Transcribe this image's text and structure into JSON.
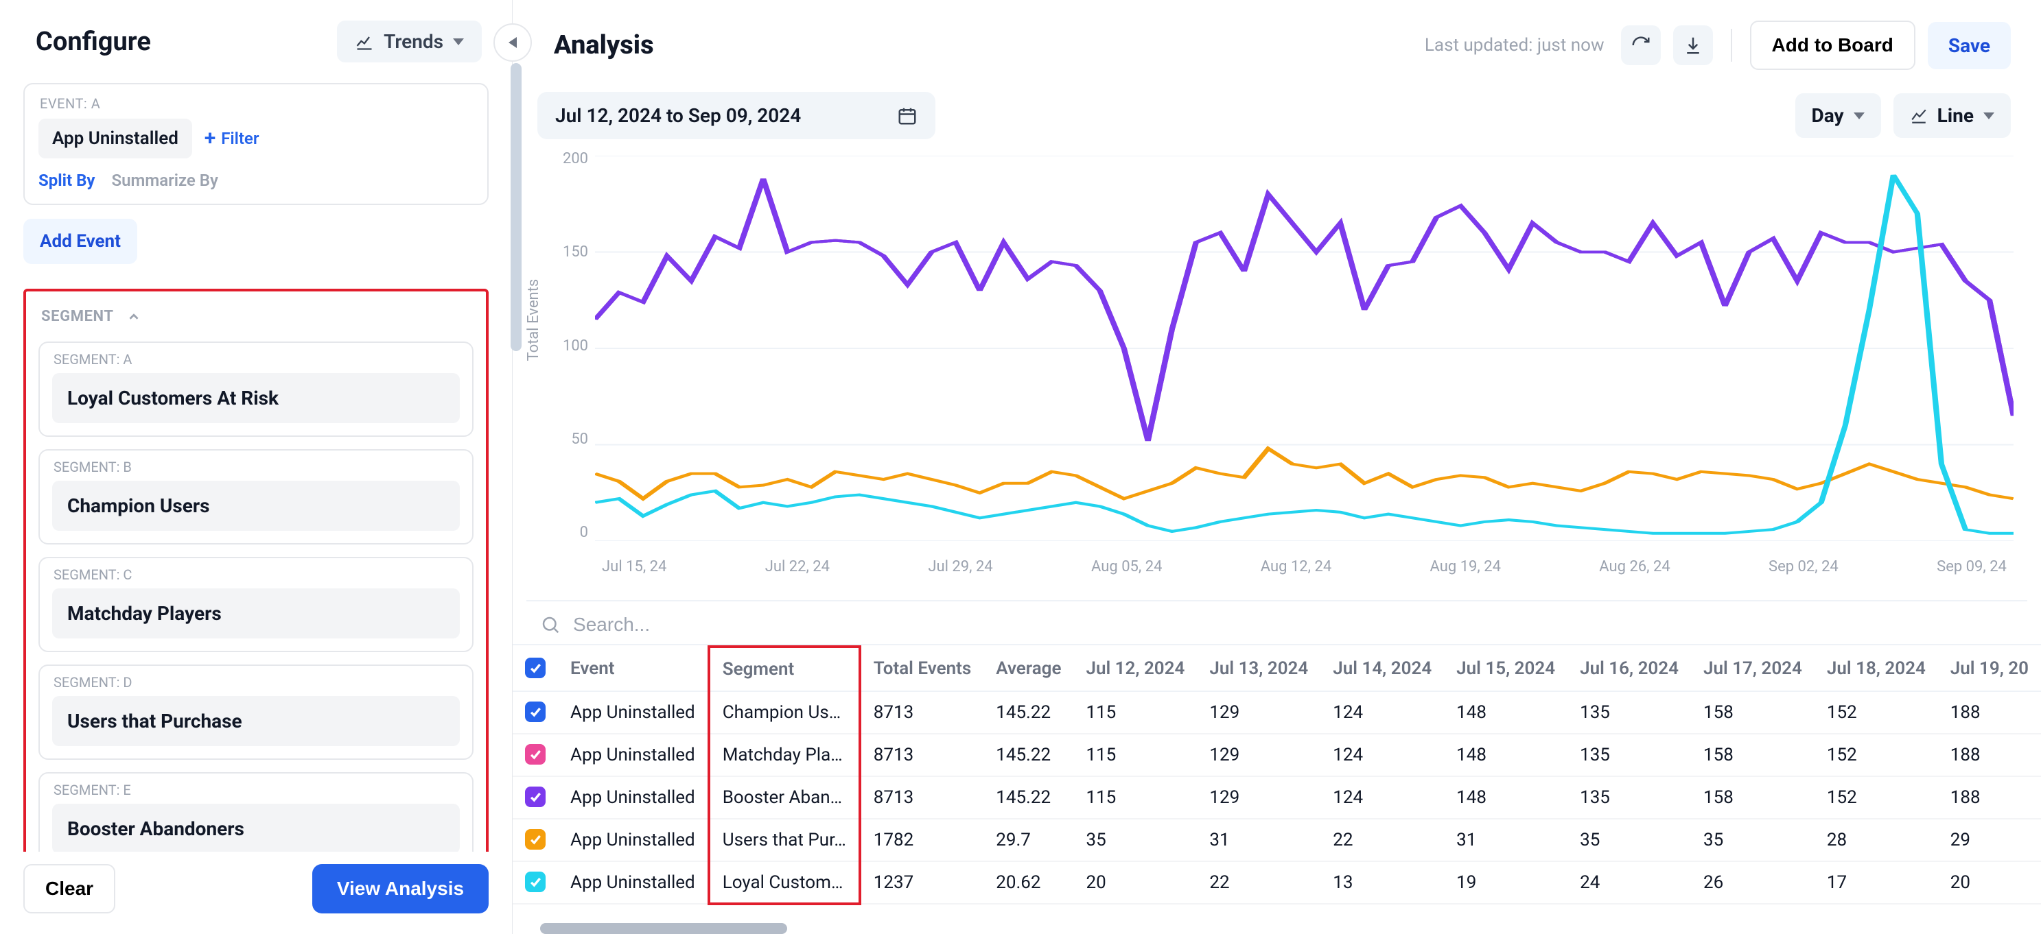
{
  "configure": {
    "title": "Configure",
    "trends_btn": "Trends",
    "event_header": "EVENT: A",
    "event_name": "App Uninstalled",
    "filter_btn": "Filter",
    "split_by": "Split By",
    "summarize_by": "Summarize By",
    "add_event": "Add Event",
    "segment_header": "SEGMENT",
    "segments": [
      {
        "label": "SEGMENT: A",
        "name": "Loyal Customers At Risk"
      },
      {
        "label": "SEGMENT: B",
        "name": "Champion Users"
      },
      {
        "label": "SEGMENT: C",
        "name": "Matchday Players"
      },
      {
        "label": "SEGMENT: D",
        "name": "Users that Purchase"
      },
      {
        "label": "SEGMENT: E",
        "name": "Booster Abandoners"
      }
    ],
    "clear_btn": "Clear",
    "view_analysis_btn": "View Analysis"
  },
  "analysis": {
    "title": "Analysis",
    "last_updated": "Last updated: just now",
    "add_to_board": "Add to Board",
    "save": "Save",
    "date_range": "Jul 12, 2024 to Sep 09, 2024",
    "granularity": "Day",
    "chart_type": "Line",
    "search_placeholder": "Search..."
  },
  "chart_data": {
    "type": "line",
    "title": "",
    "xlabel": "",
    "ylabel": "Total Events",
    "ylim": [
      0,
      200
    ],
    "y_ticks": [
      "200",
      "150",
      "100",
      "50",
      "0"
    ],
    "x_tick_labels": [
      "Jul 15, 24",
      "Jul 22, 24",
      "Jul 29, 24",
      "Aug 05, 24",
      "Aug 12, 24",
      "Aug 19, 24",
      "Aug 26, 24",
      "Sep 02, 24",
      "Sep 09, 24"
    ],
    "x": [
      0,
      1,
      2,
      3,
      4,
      5,
      6,
      7,
      8,
      9,
      10,
      11,
      12,
      13,
      14,
      15,
      16,
      17,
      18,
      19,
      20,
      21,
      22,
      23,
      24,
      25,
      26,
      27,
      28,
      29,
      30,
      31,
      32,
      33,
      34,
      35,
      36,
      37,
      38,
      39,
      40,
      41,
      42,
      43,
      44,
      45,
      46,
      47,
      48,
      49,
      50,
      51,
      52,
      53,
      54,
      55,
      56,
      57,
      58,
      59
    ],
    "series": [
      {
        "name": "Champion Users",
        "color": "#2563eb",
        "values": [
          115,
          129,
          124,
          148,
          135,
          158,
          152,
          188,
          150,
          155,
          156,
          155,
          148,
          133,
          150,
          155,
          130,
          155,
          136,
          145,
          143,
          130,
          100,
          52,
          110,
          155,
          160,
          140,
          180,
          165,
          150,
          165,
          120,
          143,
          145,
          168,
          174,
          160,
          141,
          165,
          155,
          150,
          150,
          145,
          165,
          148,
          155,
          122,
          150,
          157,
          135,
          160,
          155,
          155,
          150,
          152,
          154,
          135,
          125,
          65
        ]
      },
      {
        "name": "Matchday Players",
        "color": "#ec4899",
        "values": [
          115,
          129,
          124,
          148,
          135,
          158,
          152,
          188,
          150,
          155,
          156,
          155,
          148,
          133,
          150,
          155,
          130,
          155,
          136,
          145,
          143,
          130,
          100,
          52,
          110,
          155,
          160,
          140,
          180,
          165,
          150,
          165,
          120,
          143,
          145,
          168,
          174,
          160,
          141,
          165,
          155,
          150,
          150,
          145,
          165,
          148,
          155,
          122,
          150,
          157,
          135,
          160,
          155,
          155,
          150,
          152,
          154,
          135,
          125,
          65
        ]
      },
      {
        "name": "Booster Abandoners",
        "color": "#7c3aed",
        "values": [
          115,
          129,
          124,
          148,
          135,
          158,
          152,
          188,
          150,
          155,
          156,
          155,
          148,
          133,
          150,
          155,
          130,
          155,
          136,
          145,
          143,
          130,
          100,
          52,
          110,
          155,
          160,
          140,
          180,
          165,
          150,
          165,
          120,
          143,
          145,
          168,
          174,
          160,
          141,
          165,
          155,
          150,
          150,
          145,
          165,
          148,
          155,
          122,
          150,
          157,
          135,
          160,
          155,
          155,
          150,
          152,
          154,
          135,
          125,
          65
        ]
      },
      {
        "name": "Users that Purchase",
        "color": "#f59e0b",
        "values": [
          35,
          31,
          22,
          31,
          35,
          35,
          28,
          29,
          32,
          28,
          36,
          34,
          32,
          35,
          32,
          29,
          25,
          30,
          30,
          36,
          34,
          28,
          22,
          26,
          30,
          38,
          35,
          33,
          48,
          40,
          38,
          40,
          30,
          35,
          28,
          32,
          34,
          33,
          28,
          30,
          28,
          26,
          30,
          36,
          35,
          32,
          36,
          35,
          34,
          32,
          27,
          30,
          35,
          40,
          36,
          32,
          30,
          28,
          24,
          22
        ]
      },
      {
        "name": "Loyal Customers At Risk",
        "color": "#22d3ee",
        "values": [
          20,
          22,
          13,
          19,
          24,
          26,
          17,
          20,
          18,
          20,
          23,
          24,
          22,
          20,
          18,
          15,
          12,
          14,
          16,
          18,
          20,
          18,
          14,
          8,
          5,
          7,
          10,
          12,
          14,
          15,
          16,
          15,
          12,
          14,
          12,
          10,
          8,
          10,
          11,
          10,
          8,
          7,
          6,
          5,
          4,
          4,
          4,
          4,
          5,
          6,
          10,
          20,
          60,
          120,
          190,
          170,
          40,
          6,
          4,
          4
        ]
      }
    ]
  },
  "table": {
    "headers": [
      "Event",
      "Segment",
      "Total Events",
      "Average",
      "Jul 12, 2024",
      "Jul 13, 2024",
      "Jul 14, 2024",
      "Jul 15, 2024",
      "Jul 16, 2024",
      "Jul 17, 2024",
      "Jul 18, 2024",
      "Jul 19, 20"
    ],
    "rows": [
      {
        "color": "#2563eb",
        "event": "App Uninstalled",
        "segment": "Champion Us…",
        "total": "8713",
        "avg": "145.22",
        "d": [
          "115",
          "129",
          "124",
          "148",
          "135",
          "158",
          "152",
          "188"
        ]
      },
      {
        "color": "#ec4899",
        "event": "App Uninstalled",
        "segment": "Matchday Pla…",
        "total": "8713",
        "avg": "145.22",
        "d": [
          "115",
          "129",
          "124",
          "148",
          "135",
          "158",
          "152",
          "188"
        ]
      },
      {
        "color": "#7c3aed",
        "event": "App Uninstalled",
        "segment": "Booster Aban…",
        "total": "8713",
        "avg": "145.22",
        "d": [
          "115",
          "129",
          "124",
          "148",
          "135",
          "158",
          "152",
          "188"
        ]
      },
      {
        "color": "#f59e0b",
        "event": "App Uninstalled",
        "segment": "Users that Pur…",
        "total": "1782",
        "avg": "29.7",
        "d": [
          "35",
          "31",
          "22",
          "31",
          "35",
          "35",
          "28",
          "29"
        ]
      },
      {
        "color": "#22d3ee",
        "event": "App Uninstalled",
        "segment": "Loyal Custom…",
        "total": "1237",
        "avg": "20.62",
        "d": [
          "20",
          "22",
          "13",
          "19",
          "24",
          "26",
          "17",
          "20"
        ]
      }
    ]
  }
}
